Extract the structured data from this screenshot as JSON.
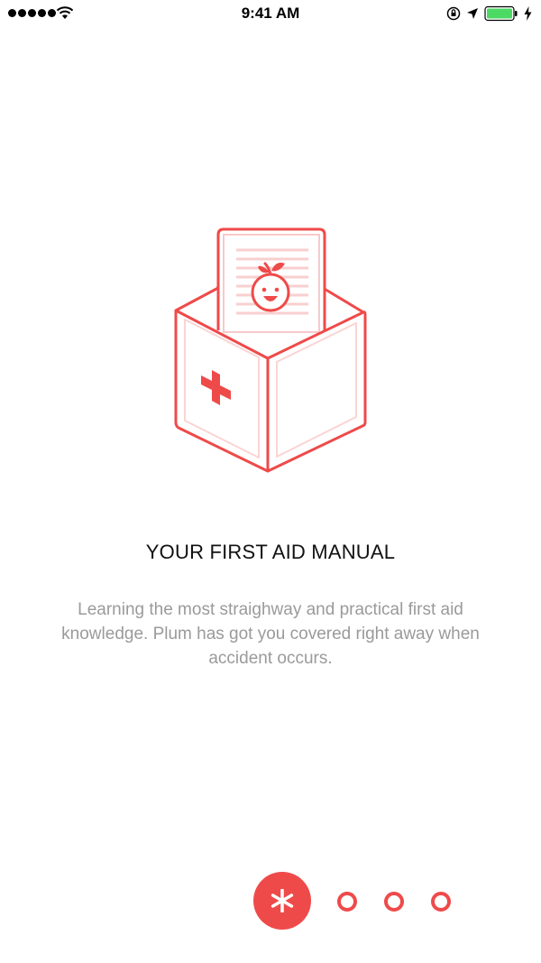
{
  "status_bar": {
    "time": "9:41 AM",
    "signal_icon": "signal-dots-icon",
    "wifi_icon": "wifi-icon",
    "orientation_lock_icon": "orientation-lock-icon",
    "location_icon": "location-arrow-icon",
    "battery_icon": "battery-icon",
    "charging_icon": "charging-bolt-icon",
    "battery_color": "#4cd964"
  },
  "onboarding": {
    "illustration": "first-aid-box-illustration",
    "title": "YOUR FIRST AID MANUAL",
    "description": "Learning the most straighway and practical first aid knowledge. Plum has got you covered right away when accident occurs."
  },
  "pager": {
    "active_icon": "asterisk-icon",
    "total_pages": 4,
    "current_page": 1,
    "accent_color": "#ef4a4a"
  }
}
